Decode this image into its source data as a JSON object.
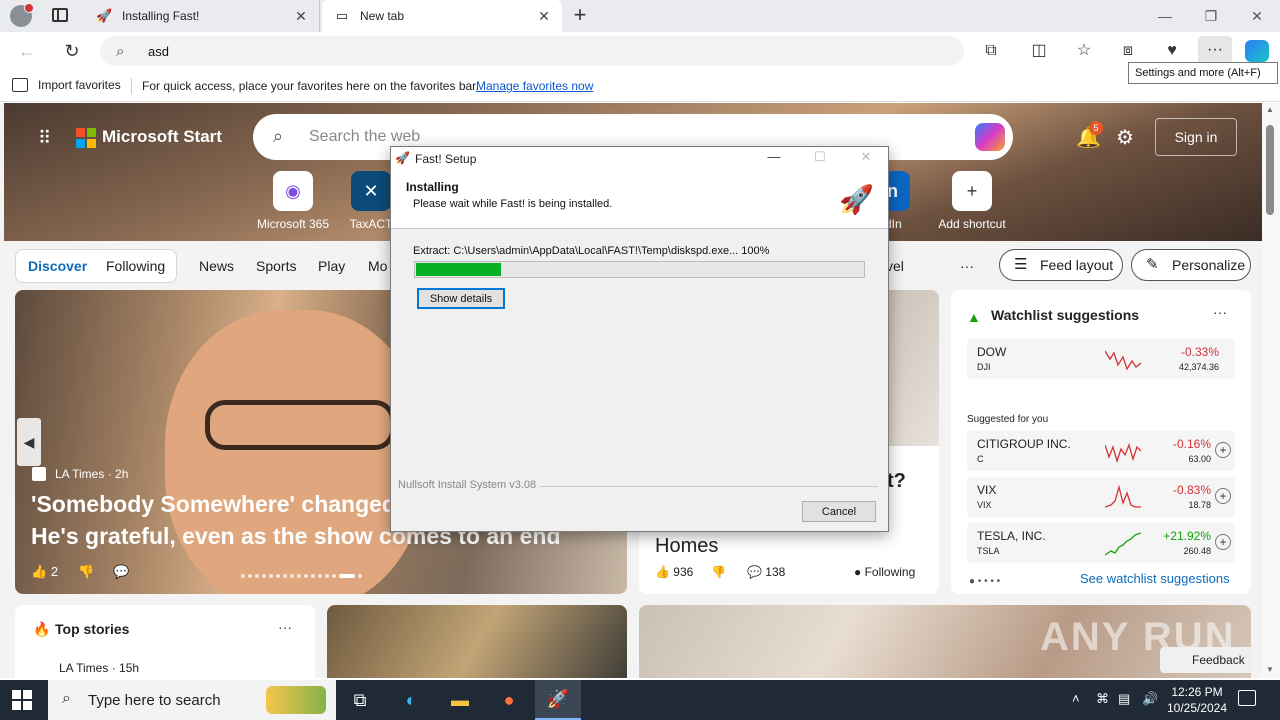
{
  "browser": {
    "tabs": [
      {
        "title": "Installing Fast!",
        "icon": "rocket-icon"
      },
      {
        "title": "New tab",
        "icon": "newtab-icon"
      }
    ],
    "address": "asd",
    "tooltip": "Settings and more (Alt+F)",
    "favorites_bar": {
      "import_label": "Import favorites",
      "message": "For quick access, place your favorites here on the favorites bar.",
      "link": "Manage favorites now"
    }
  },
  "msn": {
    "brand": "Microsoft Start",
    "search_placeholder": "Search the web",
    "notification_count": "5",
    "signin": "Sign in",
    "shortcuts": [
      {
        "label": "Microsoft 365",
        "icon": "m365-icon"
      },
      {
        "label": "TaxACT",
        "icon": "taxact-icon"
      },
      {
        "label": "edIn",
        "icon": "linkedin-icon"
      },
      {
        "label": "Add shortcut",
        "icon": "plus-icon"
      }
    ],
    "nav": {
      "discover": "Discover",
      "following": "Following",
      "items": [
        "News",
        "Sports",
        "Play",
        "Mo",
        "vel"
      ],
      "more": "···",
      "feed_layout": "Feed layout",
      "personalize": "Personalize"
    },
    "main_story": {
      "source": "LA Times",
      "age": "2h",
      "headline": "'Somebody Somewhere' changed\nHe's grateful, even as the show comes to an end",
      "likes": "2"
    },
    "mid_story": {
      "title_tail": "t?",
      "title": "Homes",
      "likes": "936",
      "comments": "138",
      "following": "Following"
    },
    "watchlist": {
      "title": "Watchlist suggestions",
      "more": "···",
      "suggested_label": "Suggested for you",
      "link": "See watchlist suggestions",
      "stocks": [
        {
          "name": "DOW",
          "ticker": "DJI",
          "change": "-0.33%",
          "price": "42,374.36",
          "color": "#d13438"
        },
        {
          "name": "CITIGROUP INC.",
          "ticker": "C",
          "change": "-0.16%",
          "price": "63.00",
          "color": "#d13438"
        },
        {
          "name": "VIX",
          "ticker": "VIX",
          "change": "-0.83%",
          "price": "18.78",
          "color": "#d13438"
        },
        {
          "name": "TESLA, INC.",
          "ticker": "TSLA",
          "change": "+21.92%",
          "price": "260.48",
          "color": "#13a10e"
        }
      ]
    },
    "top_stories": {
      "title": "Top stories",
      "more": "···",
      "source": "LA Times · 15h"
    },
    "feedback": "Feedback",
    "watermark": "ANY RUN"
  },
  "installer": {
    "title": "Fast! Setup",
    "header": "Installing",
    "subheader": "Please wait while Fast! is being installed.",
    "status": "Extract: C:\\Users\\admin\\AppData\\Local\\FAST!\\Temp\\diskspd.exe... 100%",
    "progress": 0.19,
    "show_details": "Show details",
    "branding": "Nullsoft Install System v3.08",
    "cancel": "Cancel"
  },
  "taskbar": {
    "search_placeholder": "Type here to search",
    "time": "12:26 PM",
    "date": "10/25/2024"
  }
}
